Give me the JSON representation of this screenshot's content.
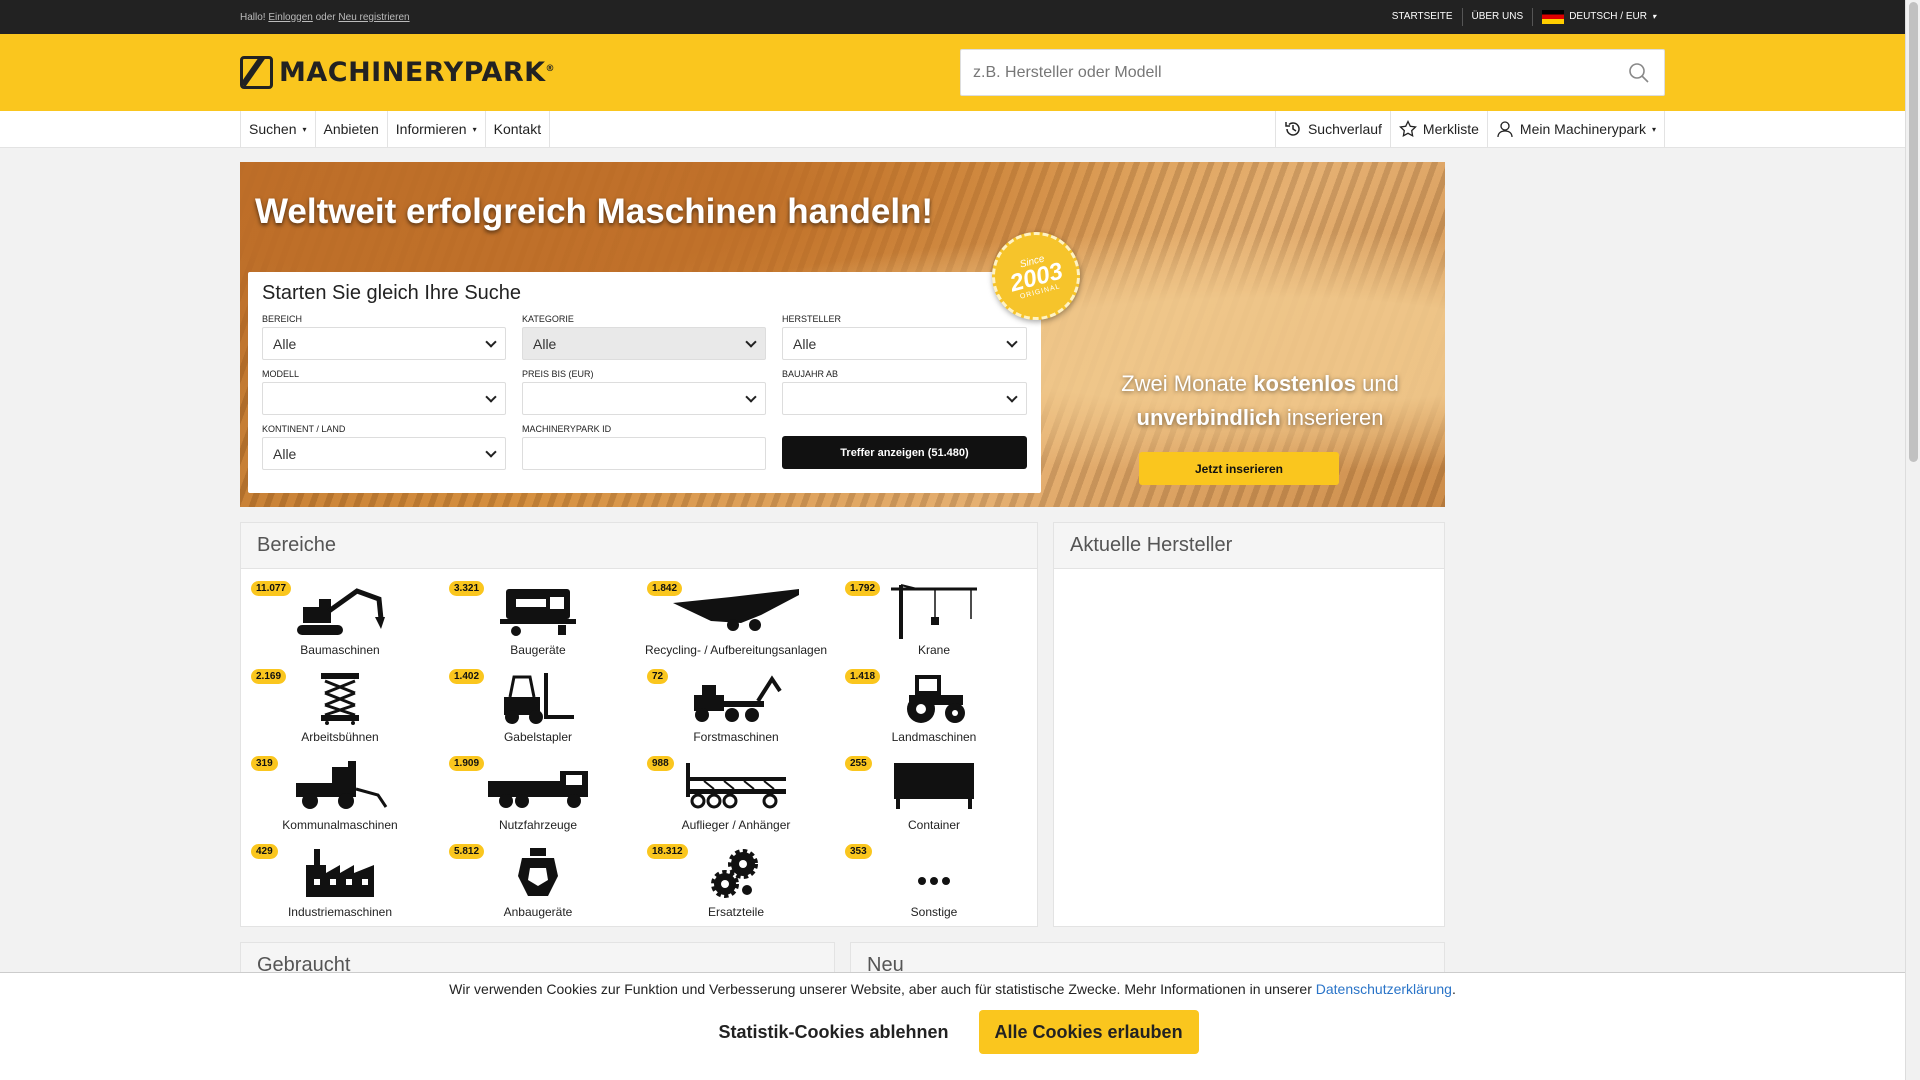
{
  "topbar": {
    "greeting": "Hallo!",
    "login": "Einloggen",
    "or": "oder",
    "register": "Neu registrieren",
    "links": [
      "STARTSEITE",
      "ÜBER UNS"
    ],
    "language": "DEUTSCH / EUR"
  },
  "header": {
    "logo": "MACHINERYPARK",
    "search_placeholder": "z.B. Hersteller oder Modell"
  },
  "nav": {
    "left": [
      "Suchen",
      "Anbieten",
      "Informieren",
      "Kontakt"
    ],
    "history": "Suchverlauf",
    "watchlist": "Merkliste",
    "account": "Mein Machinerypark"
  },
  "hero": {
    "title": "Weltweit erfolgreich Maschinen handeln!",
    "badge": {
      "since": "Since",
      "year": "2003",
      "original": "ORIGINAL"
    },
    "search_title": "Starten Sie gleich Ihre Suche",
    "fields": {
      "bereich": {
        "label": "BEREICH",
        "value": "Alle"
      },
      "kategorie": {
        "label": "KATEGORIE",
        "value": "Alle"
      },
      "hersteller": {
        "label": "HERSTELLER",
        "value": "Alle"
      },
      "modell": {
        "label": "MODELL",
        "value": ""
      },
      "preis": {
        "label": "PREIS BIS (EUR)",
        "value": ""
      },
      "baujahr": {
        "label": "BAUJAHR AB",
        "value": ""
      },
      "land": {
        "label": "KONTINENT / LAND",
        "value": "Alle"
      },
      "id": {
        "label": "MACHINERYPARK ID",
        "value": ""
      }
    },
    "submit": "Treffer anzeigen (51.480)",
    "promo_1": "Zwei Monate",
    "promo_2": "kostenlos",
    "promo_3": "und",
    "promo_4": "unverbindlich",
    "promo_5": "inserieren",
    "promo_button": "Jetzt inserieren"
  },
  "bereiche": {
    "title": "Bereiche",
    "items": [
      {
        "count": "11.077",
        "label": "Baumaschinen",
        "icon": "excavator-icon"
      },
      {
        "count": "3.321",
        "label": "Baugeräte",
        "icon": "generator-icon"
      },
      {
        "count": "1.842",
        "label": "Recycling- / Aufbereitungsanlagen",
        "icon": "crusher-icon"
      },
      {
        "count": "1.792",
        "label": "Krane",
        "icon": "crane-icon"
      },
      {
        "count": "2.169",
        "label": "Arbeitsbühnen",
        "icon": "scissor-lift-icon"
      },
      {
        "count": "1.402",
        "label": "Gabelstapler",
        "icon": "forklift-icon"
      },
      {
        "count": "72",
        "label": "Forstmaschinen",
        "icon": "forestry-icon"
      },
      {
        "count": "1.418",
        "label": "Landmaschinen",
        "icon": "tractor-icon"
      },
      {
        "count": "319",
        "label": "Kommunalmaschinen",
        "icon": "municipal-vehicle-icon"
      },
      {
        "count": "1.909",
        "label": "Nutzfahrzeuge",
        "icon": "truck-icon"
      },
      {
        "count": "988",
        "label": "Auflieger / Anhänger",
        "icon": "trailer-icon"
      },
      {
        "count": "255",
        "label": "Container",
        "icon": "container-icon"
      },
      {
        "count": "429",
        "label": "Industriemaschinen",
        "icon": "factory-icon"
      },
      {
        "count": "5.812",
        "label": "Anbaugeräte",
        "icon": "attachment-icon"
      },
      {
        "count": "18.312",
        "label": "Ersatzteile",
        "icon": "gears-icon"
      },
      {
        "count": "353",
        "label": "Sonstige",
        "icon": "more-icon"
      }
    ]
  },
  "hersteller": {
    "title": "Aktuelle Hersteller"
  },
  "gebraucht": {
    "title": "Gebraucht"
  },
  "neu": {
    "title": "Neu"
  },
  "cookie": {
    "text": "Wir verwenden Cookies zur Funktion und Verbesserung unserer Website, aber auch für statistische Zwecke. Mehr Informationen in unserer",
    "link": "Datenschutzerklärung",
    "decline": "Statistik-Cookies ablehnen",
    "accept": "Alle Cookies erlauben"
  },
  "colors": {
    "accent": "#fac61e",
    "dark": "#222222",
    "link": "#2a74c8"
  }
}
